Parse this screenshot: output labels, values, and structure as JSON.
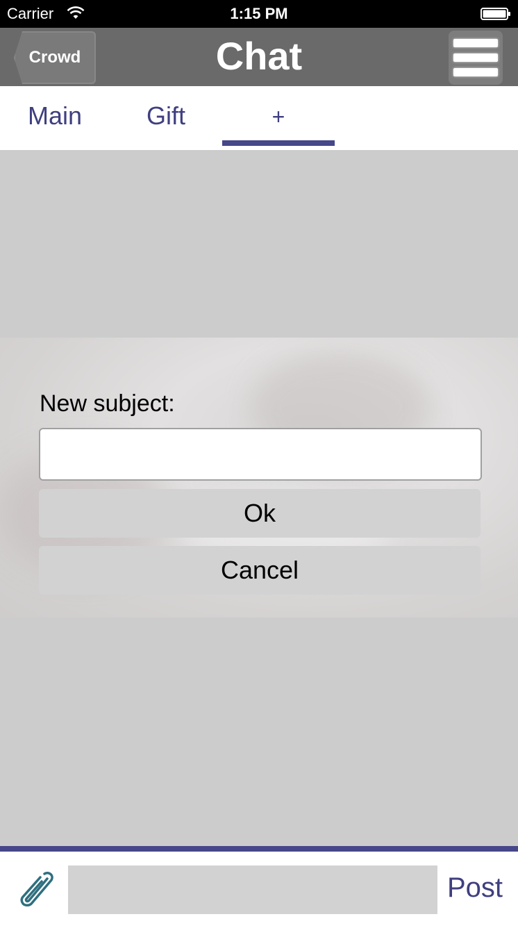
{
  "status_bar": {
    "carrier": "Carrier",
    "time": "1:15 PM",
    "wifi_icon": "wifi-icon",
    "battery_icon": "battery-icon"
  },
  "nav": {
    "back_label": "Crowd",
    "title": "Chat",
    "menu_icon": "hamburger-menu-icon"
  },
  "tabs": [
    {
      "label": "Main",
      "selected": false
    },
    {
      "label": "Gift",
      "selected": false
    },
    {
      "label": "+",
      "selected": true
    }
  ],
  "dialog": {
    "label": "New subject:",
    "input_value": "",
    "ok_label": "Ok",
    "cancel_label": "Cancel"
  },
  "compose": {
    "attach_icon": "paperclip-icon",
    "message_value": "",
    "post_label": "Post"
  },
  "colors": {
    "accent": "#46468a",
    "nav_background": "#6a6a6a",
    "content_background": "#cccccc"
  }
}
